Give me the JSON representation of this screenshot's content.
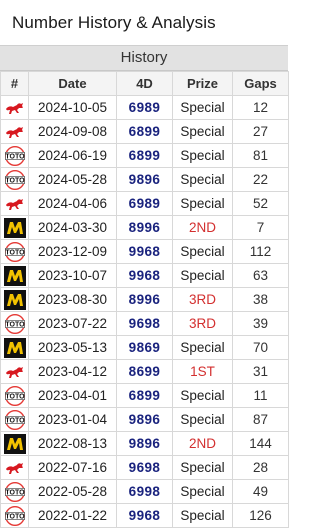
{
  "app": {
    "title": "Number History & Analysis"
  },
  "section": {
    "title": "History"
  },
  "table": {
    "headers": [
      "#",
      "Date",
      "4D",
      "Prize",
      "Gaps"
    ],
    "rows": [
      {
        "logo": "magnum-horse",
        "date": "2024-10-05",
        "number": "6989",
        "prize": "Special",
        "gap": "12"
      },
      {
        "logo": "magnum-horse",
        "date": "2024-09-08",
        "number": "6899",
        "prize": "Special",
        "gap": "27"
      },
      {
        "logo": "toto",
        "date": "2024-06-19",
        "number": "6899",
        "prize": "Special",
        "gap": "81"
      },
      {
        "logo": "toto",
        "date": "2024-05-28",
        "number": "9896",
        "prize": "Special",
        "gap": "22"
      },
      {
        "logo": "magnum-horse",
        "date": "2024-04-06",
        "number": "6989",
        "prize": "Special",
        "gap": "52"
      },
      {
        "logo": "damacai",
        "date": "2024-03-30",
        "number": "8996",
        "prize": "2ND",
        "gap": "7"
      },
      {
        "logo": "toto",
        "date": "2023-12-09",
        "number": "9968",
        "prize": "Special",
        "gap": "112"
      },
      {
        "logo": "damacai",
        "date": "2023-10-07",
        "number": "9968",
        "prize": "Special",
        "gap": "63"
      },
      {
        "logo": "damacai",
        "date": "2023-08-30",
        "number": "8996",
        "prize": "3RD",
        "gap": "38"
      },
      {
        "logo": "toto",
        "date": "2023-07-22",
        "number": "9698",
        "prize": "3RD",
        "gap": "39"
      },
      {
        "logo": "damacai",
        "date": "2023-05-13",
        "number": "9869",
        "prize": "Special",
        "gap": "70"
      },
      {
        "logo": "magnum-horse",
        "date": "2023-04-12",
        "number": "8699",
        "prize": "1ST",
        "gap": "31"
      },
      {
        "logo": "toto",
        "date": "2023-04-01",
        "number": "6899",
        "prize": "Special",
        "gap": "11"
      },
      {
        "logo": "toto",
        "date": "2023-01-04",
        "number": "9896",
        "prize": "Special",
        "gap": "87"
      },
      {
        "logo": "damacai",
        "date": "2022-08-13",
        "number": "9896",
        "prize": "2ND",
        "gap": "144"
      },
      {
        "logo": "magnum-horse",
        "date": "2022-07-16",
        "number": "9698",
        "prize": "Special",
        "gap": "28"
      },
      {
        "logo": "toto",
        "date": "2022-05-28",
        "number": "6998",
        "prize": "Special",
        "gap": "49"
      },
      {
        "logo": "toto",
        "date": "2022-01-22",
        "number": "9968",
        "prize": "Special",
        "gap": "126"
      }
    ]
  },
  "colors": {
    "number": "#1a237e",
    "prize_highlight": "#d32f2f",
    "magnum_red": "#d71920",
    "damacai_yellow": "#f2c200",
    "toto_red": "#e53935"
  },
  "logo_labels": {
    "toto": "TOTO",
    "damacai": "M"
  }
}
